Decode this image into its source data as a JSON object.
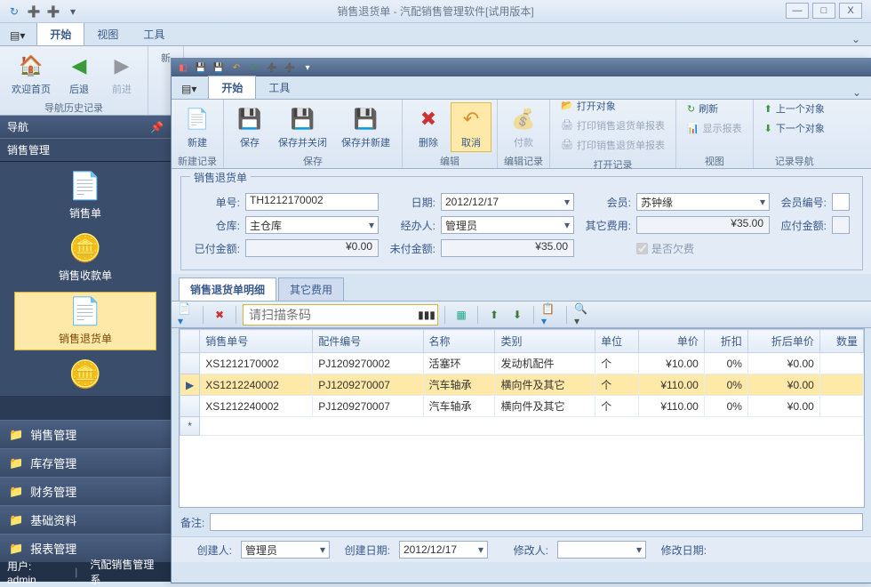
{
  "window": {
    "title": "销售退货单 - 汽配销售管理软件[试用版本]",
    "min": "—",
    "max": "□",
    "close": "X"
  },
  "outer_tabs": {
    "start": "开始",
    "view": "视图",
    "tools": "工具"
  },
  "outer_ribbon": {
    "home": "欢迎首页",
    "back": "后退",
    "forward": "前进",
    "hist_group": "导航历史记录",
    "new_group": "新"
  },
  "sidebar": {
    "nav_title": "导航",
    "section": "销售管理",
    "cards": [
      {
        "label": "销售单"
      },
      {
        "label": "销售收款单"
      },
      {
        "label": "销售退货单"
      }
    ],
    "groups": [
      "销售管理",
      "库存管理",
      "财务管理",
      "基础资料",
      "报表管理"
    ]
  },
  "status": {
    "user_label": "用户:",
    "user": "admin",
    "app": "汽配销售管理系"
  },
  "child": {
    "tabs": {
      "start": "开始",
      "tools": "工具"
    },
    "ribbon": {
      "new": "新建",
      "save": "保存",
      "save_close": "保存并关闭",
      "save_new": "保存并新建",
      "delete": "删除",
      "cancel": "取消",
      "pay": "付款",
      "open_obj": "打开对象",
      "print1": "打印销售退货单报表",
      "print2": "打印销售退货单报表",
      "refresh": "刷新",
      "show_report": "显示报表",
      "prev": "上一个对象",
      "next": "下一个对象",
      "grp_new": "新建记录",
      "grp_save": "保存",
      "grp_edit": "编辑",
      "grp_editrec": "编辑记录",
      "grp_open": "打开记录",
      "grp_view": "视图",
      "grp_nav": "记录导航"
    },
    "form": {
      "box_title": "销售退货单",
      "no_lbl": "单号:",
      "no": "TH1212170002",
      "date_lbl": "日期:",
      "date": "2012/12/17",
      "member_lbl": "会员:",
      "member": "苏钟缘",
      "member_no_lbl": "会员编号:",
      "wh_lbl": "仓库:",
      "wh": "主仓库",
      "op_lbl": "经办人:",
      "op": "管理员",
      "other_lbl": "其它费用:",
      "other": "¥35.00",
      "due_lbl": "应付金额:",
      "paid_lbl": "已付金额:",
      "paid": "¥0.00",
      "unpaid_lbl": "未付金额:",
      "unpaid": "¥35.00",
      "owe_lbl": "是否欠费"
    },
    "detail_tabs": {
      "items": "销售退货单明细",
      "other": "其它费用"
    },
    "scan_placeholder": "请扫描条码",
    "grid": {
      "cols": [
        "销售单号",
        "配件编号",
        "名称",
        "类别",
        "单位",
        "单价",
        "折扣",
        "折后单价",
        "数量"
      ],
      "rows": [
        {
          "sn": "XS1212170002",
          "pn": "PJ1209270002",
          "name": "活塞环",
          "cat": "发动机配件",
          "unit": "个",
          "price": "¥10.00",
          "disc": "0%",
          "dprice": "¥0.00"
        },
        {
          "sn": "XS1212240002",
          "pn": "PJ1209270007",
          "name": "汽车轴承",
          "cat": "横向件及其它",
          "unit": "个",
          "price": "¥110.00",
          "disc": "0%",
          "dprice": "¥0.00"
        },
        {
          "sn": "XS1212240002",
          "pn": "PJ1209270007",
          "name": "汽车轴承",
          "cat": "横向件及其它",
          "unit": "个",
          "price": "¥110.00",
          "disc": "0%",
          "dprice": "¥0.00"
        }
      ]
    },
    "remark_lbl": "备注:",
    "footer": {
      "creator_lbl": "创建人:",
      "creator": "管理员",
      "cdate_lbl": "创建日期:",
      "cdate": "2012/12/17",
      "mod_lbl": "修改人:",
      "mdate_lbl": "修改日期:"
    }
  }
}
